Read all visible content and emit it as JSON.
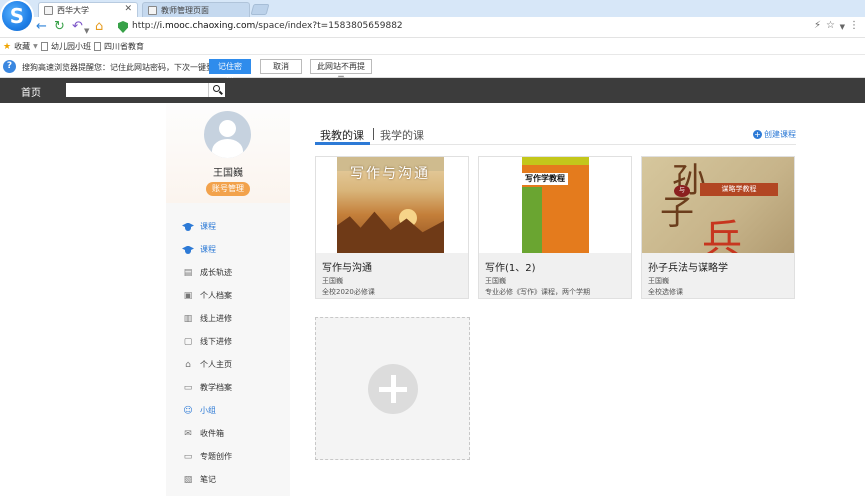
{
  "browser": {
    "logo_letter": "S",
    "tabs": [
      {
        "label": "西华大学",
        "active": true
      },
      {
        "label": "教师管理页面",
        "active": false
      }
    ],
    "url_prefix": "http://",
    "url_host": "i.mooc.chaoxing.com",
    "url_path": "/space/index?t=1583805659882",
    "window_controls": "⚡ ☆ ▾ ⋮"
  },
  "bookmarks": {
    "favorites_label": "收藏",
    "items": [
      "幼儿园小班",
      "四川省教育"
    ]
  },
  "password_prompt": {
    "message": "搜狗高速浏览器提醒您：记住此网站密码，下次一键登录!",
    "remember_label": "记住密码",
    "cancel_label": "取消",
    "never_label": "此网站不再提示"
  },
  "header": {
    "home_label": "首页",
    "search_value": ""
  },
  "profile": {
    "name": "王国巍",
    "account_button": "账号管理"
  },
  "sidebar": {
    "items": [
      {
        "label": "课程",
        "icon": "cap-icon",
        "active": true
      },
      {
        "label": "课程",
        "icon": "cap-icon",
        "active": true
      },
      {
        "label": "成长轨迹",
        "icon": "growth-icon",
        "active": false
      },
      {
        "label": "个人档案",
        "icon": "profile-card-icon",
        "active": false
      },
      {
        "label": "线上进修",
        "icon": "chart-icon",
        "active": false
      },
      {
        "label": "线下进修",
        "icon": "book-icon",
        "active": false
      },
      {
        "label": "个人主页",
        "icon": "house-icon",
        "active": false
      },
      {
        "label": "教学档案",
        "icon": "folder-icon",
        "active": false
      },
      {
        "label": "小组",
        "icon": "group-icon",
        "active": true
      },
      {
        "label": "收件箱",
        "icon": "mail-icon",
        "active": false
      },
      {
        "label": "专题创作",
        "icon": "window-icon",
        "active": false
      },
      {
        "label": "笔记",
        "icon": "note-icon",
        "active": false
      }
    ]
  },
  "main": {
    "tab_teach": "我教的课",
    "tab_learn": "我学的课",
    "create_course": "创建课程",
    "courses": [
      {
        "title": "写作与沟通",
        "teacher": "王国巍",
        "desc": "全校2020必修课",
        "cover_text": "写作与沟通"
      },
      {
        "title": "写作(1、2)",
        "teacher": "王国巍",
        "desc": "专业必修《写作》课程，两个学期",
        "cover_text": "写作学教程"
      },
      {
        "title": "孙子兵法与谋略学",
        "teacher": "王国巍",
        "desc": "全校选修课",
        "cover_text": "谋略学教程"
      }
    ]
  }
}
